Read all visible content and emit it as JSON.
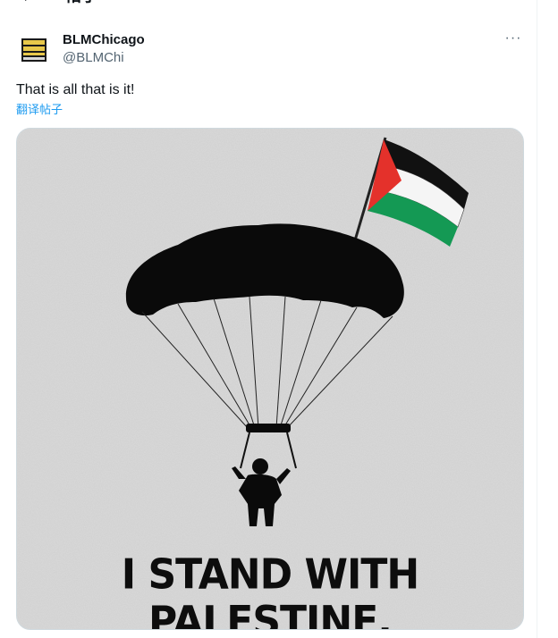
{
  "header": {
    "title": "帖子"
  },
  "tweet": {
    "author_name": "BLMChicago",
    "author_handle": "@BLMChi",
    "more_label": "···",
    "text": "That is all that is it!",
    "translate_label": "翻译帖子",
    "image_caption": "I STAND WITH PALESTINE."
  },
  "colors": {
    "link": "#1d9bf0",
    "secondary_text": "#536471",
    "flag_red": "#e4312b",
    "flag_green": "#149954",
    "flag_black": "#000000"
  },
  "icons": [
    "back-arrow-icon",
    "more-icon"
  ]
}
